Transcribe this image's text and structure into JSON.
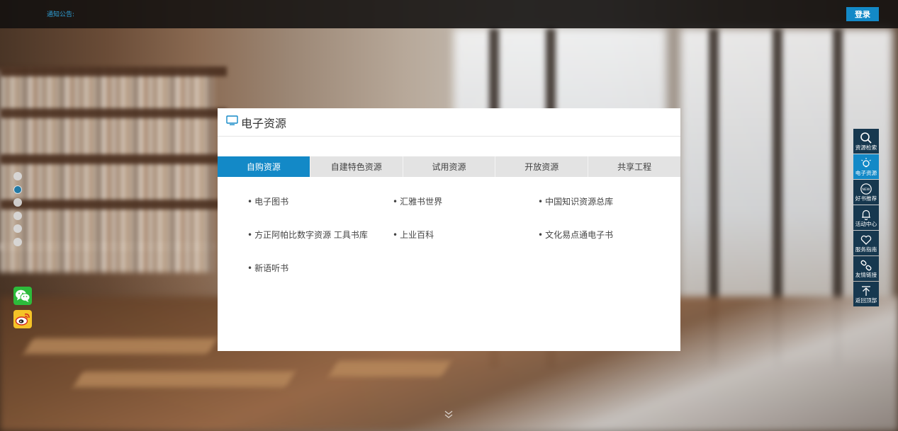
{
  "topbar": {
    "notice_label": "通知公告:",
    "login_label": "登录"
  },
  "panel": {
    "title": "电子资源",
    "tabs": [
      {
        "label": "自购资源",
        "active": true
      },
      {
        "label": "自建特色资源",
        "active": false
      },
      {
        "label": "试用资源",
        "active": false
      },
      {
        "label": "开放资源",
        "active": false
      },
      {
        "label": "共享工程",
        "active": false
      }
    ],
    "items": [
      "电子图书",
      "汇雅书世界",
      "中国知识资源总库",
      "方正阿帕比数字资源 工具书库",
      "上业百科",
      "文化易点通电子书",
      "新语听书"
    ]
  },
  "sidebar": {
    "items": [
      {
        "label": "资源检索",
        "icon": "search-icon"
      },
      {
        "label": "电子资源",
        "icon": "bulb-icon",
        "active": true
      },
      {
        "label": "好书推荐",
        "icon": "new-badge-icon"
      },
      {
        "label": "活动中心",
        "icon": "bell-icon"
      },
      {
        "label": "服务指南",
        "icon": "heart-icon"
      },
      {
        "label": "友情链接",
        "icon": "link-icon"
      },
      {
        "label": "返回顶部",
        "icon": "back-to-top-icon"
      }
    ]
  },
  "nav_dots": {
    "count": 6,
    "active_index": 1
  },
  "colors": {
    "accent": "#1389c7",
    "sidebar_bg": "#17384f",
    "notice_text": "#2f9fd6"
  }
}
